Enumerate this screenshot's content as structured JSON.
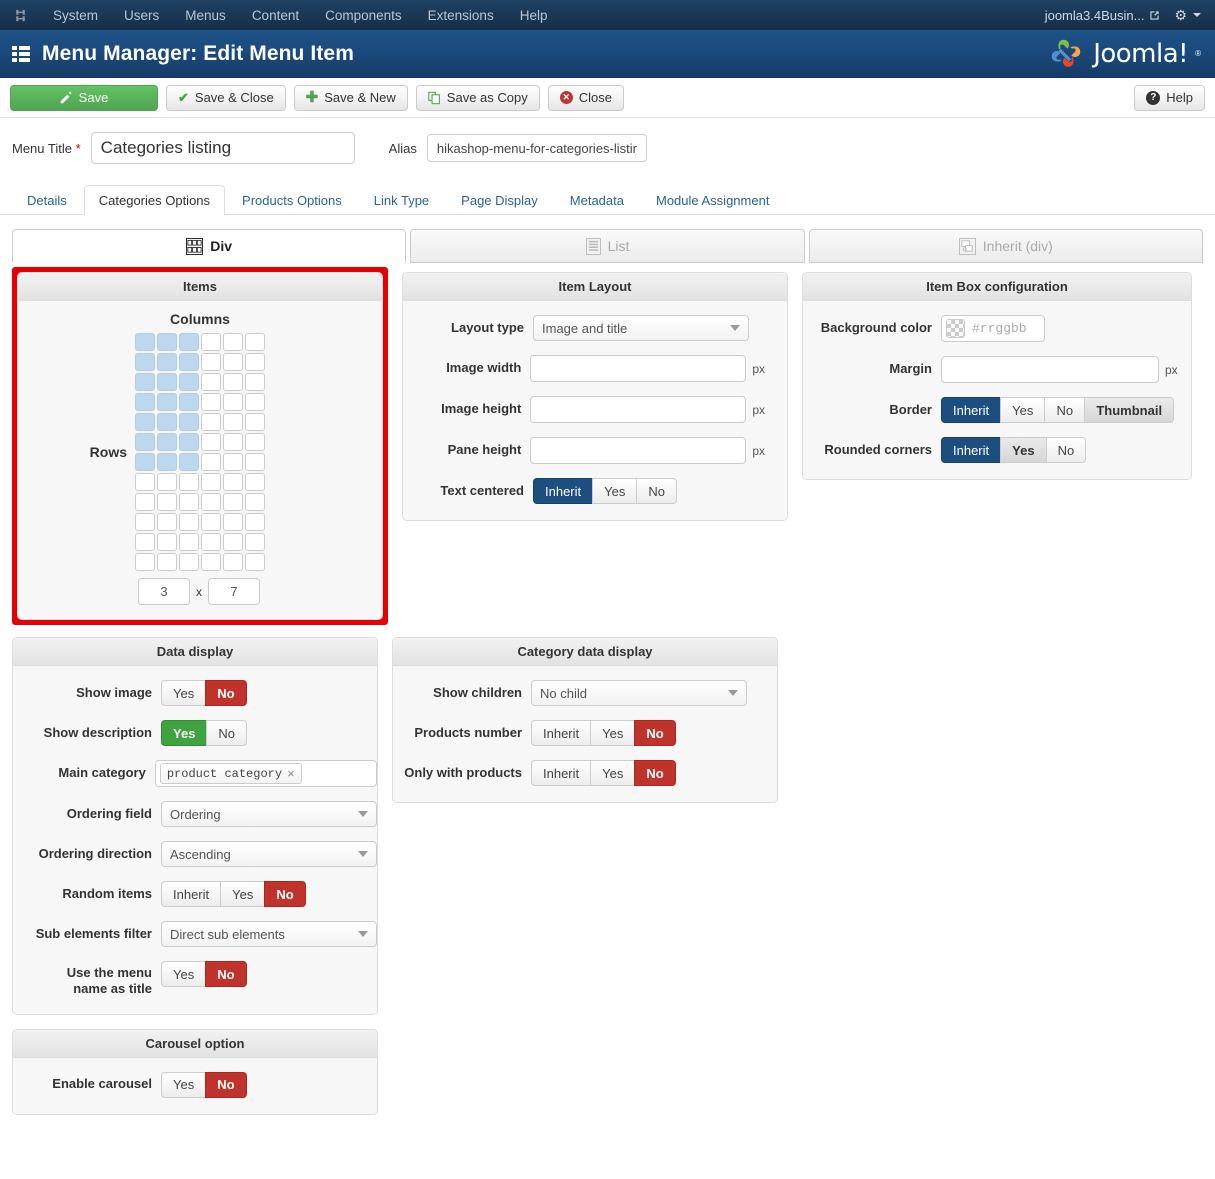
{
  "adminbar": {
    "brand_icon": "joomla-brand-icon",
    "menu": [
      "System",
      "Users",
      "Menus",
      "Content",
      "Components",
      "Extensions",
      "Help"
    ],
    "user": "joomla3.4Busin...",
    "external_icon": "external-link-icon",
    "gear_icon": "gear-icon"
  },
  "header": {
    "icon": "menu-list-icon",
    "title": "Menu Manager: Edit Menu Item",
    "logo_text": "Joomla!",
    "logo_reg": "®"
  },
  "toolbar": {
    "save": "Save",
    "save_close": "Save & Close",
    "save_new": "Save & New",
    "save_copy": "Save as Copy",
    "close": "Close",
    "help": "Help"
  },
  "titlerow": {
    "menu_title_label": "Menu Title",
    "required_mark": "*",
    "menu_title_value": "Categories listing",
    "alias_label": "Alias",
    "alias_value": "hikashop-menu-for-categories-listing"
  },
  "tabs": [
    {
      "label": "Details",
      "active": false
    },
    {
      "label": "Categories Options",
      "active": true
    },
    {
      "label": "Products Options",
      "active": false
    },
    {
      "label": "Link Type",
      "active": false
    },
    {
      "label": "Page Display",
      "active": false
    },
    {
      "label": "Metadata",
      "active": false
    },
    {
      "label": "Module Assignment",
      "active": false
    }
  ],
  "subtabs": [
    {
      "label": "Div",
      "icon": "grid-boxes-icon",
      "active": true
    },
    {
      "label": "List",
      "icon": "list-lines-icon",
      "active": false
    },
    {
      "label": "Inherit (div)",
      "icon": "inherit-windows-icon",
      "active": false
    }
  ],
  "items_panel": {
    "title": "Items",
    "columns_label": "Columns",
    "rows_label": "Rows",
    "grid_cols": 6,
    "grid_rows": 12,
    "selected_cols": 3,
    "selected_rows": 7,
    "cols_value": "3",
    "x_symbol": "x",
    "rows_value": "7"
  },
  "item_layout_panel": {
    "title": "Item Layout",
    "layout_type_label": "Layout type",
    "layout_type_value": "Image and title",
    "image_width_label": "Image width",
    "image_width_value": "",
    "image_height_label": "Image height",
    "image_height_value": "",
    "pane_height_label": "Pane height",
    "pane_height_value": "",
    "px_unit": "px",
    "text_centered_label": "Text centered",
    "text_centered_options": [
      "Inherit",
      "Yes",
      "No"
    ],
    "text_centered_selected": "Inherit"
  },
  "item_box_panel": {
    "title": "Item Box configuration",
    "bg_color_label": "Background color",
    "bg_color_placeholder": "#rrggbb",
    "bg_color_swatch": "checkerboard-transparent",
    "margin_label": "Margin",
    "margin_value": "",
    "px_unit": "px",
    "border_label": "Border",
    "border_options": [
      "Inherit",
      "Yes",
      "No",
      "Thumbnail"
    ],
    "border_selected": "Inherit",
    "rounded_label": "Rounded corners",
    "rounded_options": [
      "Inherit",
      "Yes",
      "No"
    ],
    "rounded_selected": "Inherit"
  },
  "data_display_panel": {
    "title": "Data display",
    "show_image_label": "Show image",
    "show_image_options": [
      "Yes",
      "No"
    ],
    "show_image_selected": "No",
    "show_description_label": "Show description",
    "show_description_options": [
      "Yes",
      "No"
    ],
    "show_description_selected": "Yes",
    "main_category_label": "Main category",
    "main_category_token": "product category",
    "main_category_remove": "×",
    "ordering_field_label": "Ordering field",
    "ordering_field_value": "Ordering",
    "ordering_direction_label": "Ordering direction",
    "ordering_direction_value": "Ascending",
    "random_items_label": "Random items",
    "random_items_options": [
      "Inherit",
      "Yes",
      "No"
    ],
    "random_items_selected": "No",
    "sub_elements_label": "Sub elements filter",
    "sub_elements_value": "Direct sub elements",
    "use_menu_name_label_line1": "Use the menu",
    "use_menu_name_label_line2": "name as title",
    "use_menu_name_options": [
      "Yes",
      "No"
    ],
    "use_menu_name_selected": "No"
  },
  "category_data_panel": {
    "title": "Category data display",
    "show_children_label": "Show children",
    "show_children_value": "No child",
    "products_number_label": "Products number",
    "products_number_options": [
      "Inherit",
      "Yes",
      "No"
    ],
    "products_number_selected": "No",
    "only_with_products_label": "Only with products",
    "only_with_products_options": [
      "Inherit",
      "Yes",
      "No"
    ],
    "only_with_products_selected": "No"
  },
  "carousel_panel": {
    "title": "Carousel option",
    "enable_label": "Enable carousel",
    "enable_options": [
      "Yes",
      "No"
    ],
    "enable_selected": "No"
  },
  "colors": {
    "adminbar": "#1c3d5c",
    "header_blue": "#1e5288",
    "save_green": "#51a351",
    "toggle_blue": "#1c4e80",
    "toggle_red": "#c0332b",
    "toggle_green": "#3fa33f",
    "highlight_red": "#e60000",
    "grid_selected": "#bcd7ee"
  }
}
